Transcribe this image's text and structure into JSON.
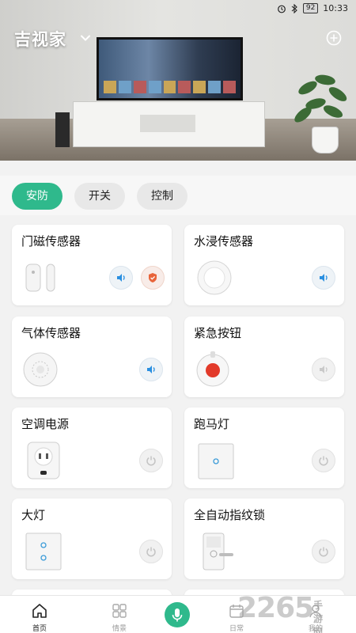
{
  "status_bar": {
    "battery": "92",
    "time": "10:33"
  },
  "header": {
    "home_name": "吉视家"
  },
  "tabs": [
    {
      "label": "安防",
      "active": true
    },
    {
      "label": "开关",
      "active": false
    },
    {
      "label": "控制",
      "active": false
    }
  ],
  "devices": {
    "door_sensor": {
      "name": "门磁传感器"
    },
    "water_sensor": {
      "name": "水浸传感器"
    },
    "gas_sensor": {
      "name": "气体传感器"
    },
    "emergency_button": {
      "name": "紧急按钮"
    },
    "ac_power": {
      "name": "空调电源"
    },
    "marquee_light": {
      "name": "跑马灯"
    },
    "main_light": {
      "name": "大灯"
    },
    "fingerprint_lock": {
      "name": "全自动指纹锁"
    }
  },
  "bottom_nav": [
    {
      "label": "首页",
      "icon": "home-icon"
    },
    {
      "label": "情景",
      "icon": "grid-icon"
    },
    {
      "label": "",
      "icon": "mic-icon"
    },
    {
      "label": "日常",
      "icon": "calendar-icon"
    },
    {
      "label": "我的",
      "icon": "user-icon"
    }
  ],
  "watermark": {
    "number": "2265",
    "suffix": "手游网"
  },
  "colors": {
    "accent": "#2fb98c"
  }
}
